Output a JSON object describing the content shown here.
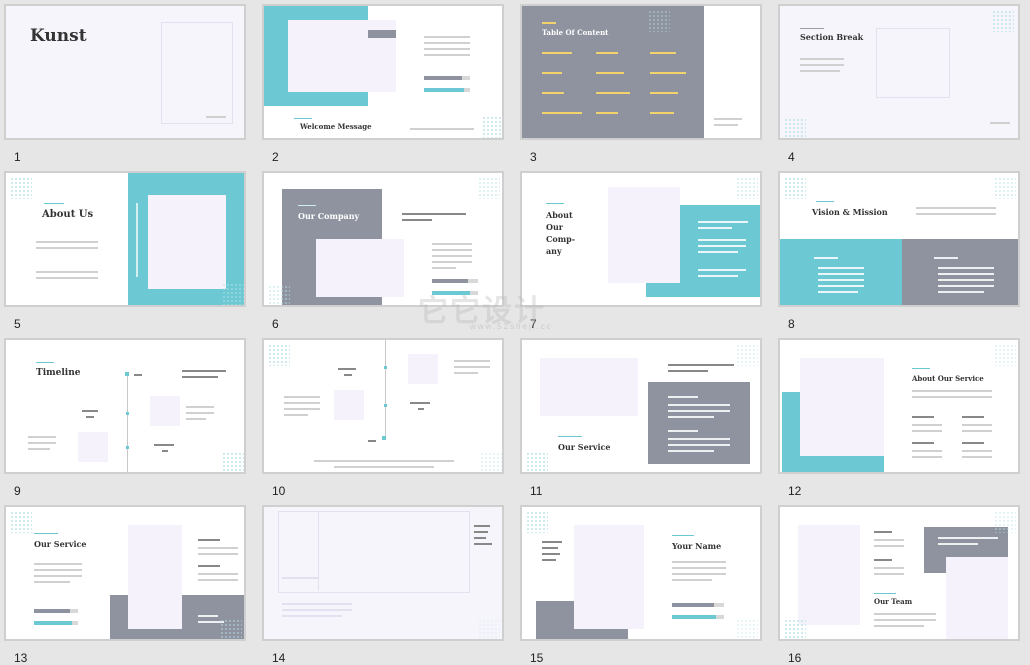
{
  "slides": [
    {
      "number": "1",
      "title": "Kunst"
    },
    {
      "number": "2",
      "title": "Welcome Message"
    },
    {
      "number": "3",
      "title": "Table Of Content"
    },
    {
      "number": "4",
      "title": "Section Break"
    },
    {
      "number": "5",
      "title": "About Us"
    },
    {
      "number": "6",
      "title": "Our Company"
    },
    {
      "number": "7",
      "title": "About Our Comp- any"
    },
    {
      "number": "8",
      "title": "Vision & Mission"
    },
    {
      "number": "9",
      "title": "Timeline"
    },
    {
      "number": "10",
      "title": ""
    },
    {
      "number": "11",
      "title": "Our Service"
    },
    {
      "number": "12",
      "title": "About Our Service"
    },
    {
      "number": "13",
      "title": "Our Service"
    },
    {
      "number": "14",
      "title": ""
    },
    {
      "number": "15",
      "title": "Your Name"
    },
    {
      "number": "16",
      "title": "Our Team"
    }
  ],
  "watermark": "它它设计",
  "watermark_url": "www.52sheji.cc",
  "colors": {
    "teal": "#6cc8d2",
    "gray": "#8e939f",
    "lavender": "#f7f5fc",
    "yellow": "#f2d36b"
  }
}
